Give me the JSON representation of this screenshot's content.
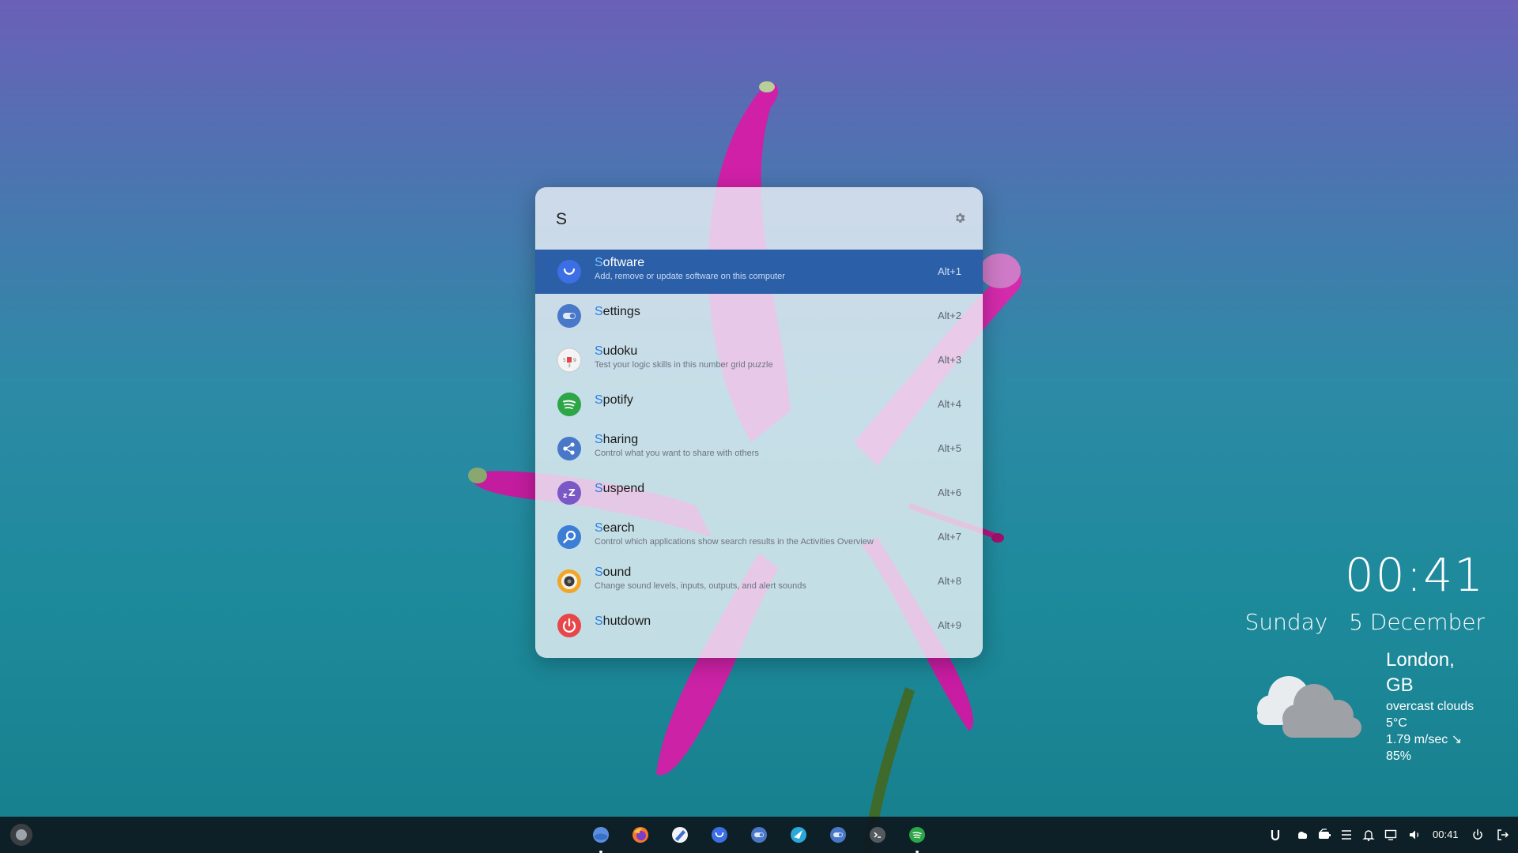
{
  "launcher": {
    "query": "S",
    "results": [
      {
        "hl": "S",
        "rest": "oftware",
        "description": "Add, remove or update software on this computer",
        "shortcut": "Alt+1",
        "icon": "software-icon"
      },
      {
        "hl": "S",
        "rest": "ettings",
        "description": "",
        "shortcut": "Alt+2",
        "icon": "settings-app-icon"
      },
      {
        "hl": "S",
        "rest": "udoku",
        "description": "Test your logic skills in this number grid puzzle",
        "shortcut": "Alt+3",
        "icon": "sudoku-icon"
      },
      {
        "hl": "S",
        "rest": "potify",
        "description": "",
        "shortcut": "Alt+4",
        "icon": "spotify-icon"
      },
      {
        "hl": "S",
        "rest": "haring",
        "description": "Control what you want to share with others",
        "shortcut": "Alt+5",
        "icon": "sharing-icon"
      },
      {
        "hl": "S",
        "rest": "uspend",
        "description": "",
        "shortcut": "Alt+6",
        "icon": "suspend-icon"
      },
      {
        "hl": "S",
        "rest": "earch",
        "description": "Control which applications show search results in the Activities Overview",
        "shortcut": "Alt+7",
        "icon": "search-app-icon"
      },
      {
        "hl": "S",
        "rest": "ound",
        "description": "Change sound levels, inputs, outputs, and alert sounds",
        "shortcut": "Alt+8",
        "icon": "sound-icon"
      },
      {
        "hl": "S",
        "rest": "hutdown",
        "description": "",
        "shortcut": "Alt+9",
        "icon": "shutdown-icon"
      }
    ]
  },
  "clock": {
    "time": "00:41",
    "day": "Sunday",
    "date": "5 December"
  },
  "weather": {
    "city": "London, GB",
    "condition": "overcast clouds",
    "temperature": "5°C",
    "wind": "1.79 m/sec ↘",
    "humidity": "85%",
    "icon": "cloud-icon"
  },
  "taskbar": {
    "time": "00:41",
    "dock": [
      "files-icon",
      "firefox-icon",
      "text-editor-icon",
      "software-icon",
      "settings-icon",
      "web-browser-icon",
      "settings-icon",
      "terminal-icon",
      "spotify-icon"
    ],
    "tray": [
      "ulauncher-icon",
      "cloud-icon",
      "battery-icon",
      "menu-icon",
      "bell-icon",
      "display-icon",
      "volume-icon",
      "power-icon",
      "logout-icon"
    ]
  },
  "colors": {
    "selected_row": "#2b5fa8",
    "match_highlight": "#2a7fe0",
    "taskbar": "#0e1a22"
  }
}
